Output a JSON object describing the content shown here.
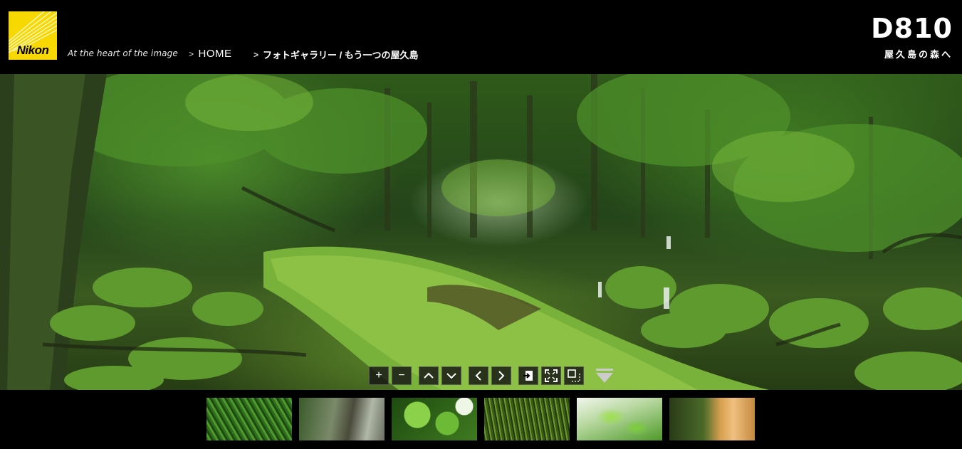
{
  "header": {
    "brand": "Nikon",
    "tagline": "At the heart of the image",
    "breadcrumbs": [
      {
        "label": "HOME"
      },
      {
        "label": "フォトギャラリー / もう一つの屋久島"
      }
    ],
    "model": "D810",
    "model_sub": "屋久島の森へ"
  },
  "viewer": {
    "controls": [
      {
        "icon": "zoom-in-icon",
        "glyph": "+"
      },
      {
        "icon": "zoom-out-icon",
        "glyph": "−"
      },
      {
        "icon": "pan-up-icon",
        "glyph": "⌃"
      },
      {
        "icon": "pan-down-icon",
        "glyph": "⌄"
      },
      {
        "icon": "pan-left-icon",
        "glyph": "‹"
      },
      {
        "icon": "pan-right-icon",
        "glyph": "›"
      },
      {
        "icon": "exit-icon",
        "glyph": ""
      },
      {
        "icon": "fullscreen-icon",
        "glyph": ""
      },
      {
        "icon": "window-icon",
        "glyph": ""
      }
    ],
    "collapse_icon": "triangle-down-icon"
  },
  "thumbnails": [
    {
      "id": "1"
    },
    {
      "id": "2"
    },
    {
      "id": "3"
    },
    {
      "id": "4"
    },
    {
      "id": "5"
    },
    {
      "id": "6"
    }
  ],
  "colors": {
    "logo_yellow": "#f7d800",
    "background": "#000000"
  }
}
